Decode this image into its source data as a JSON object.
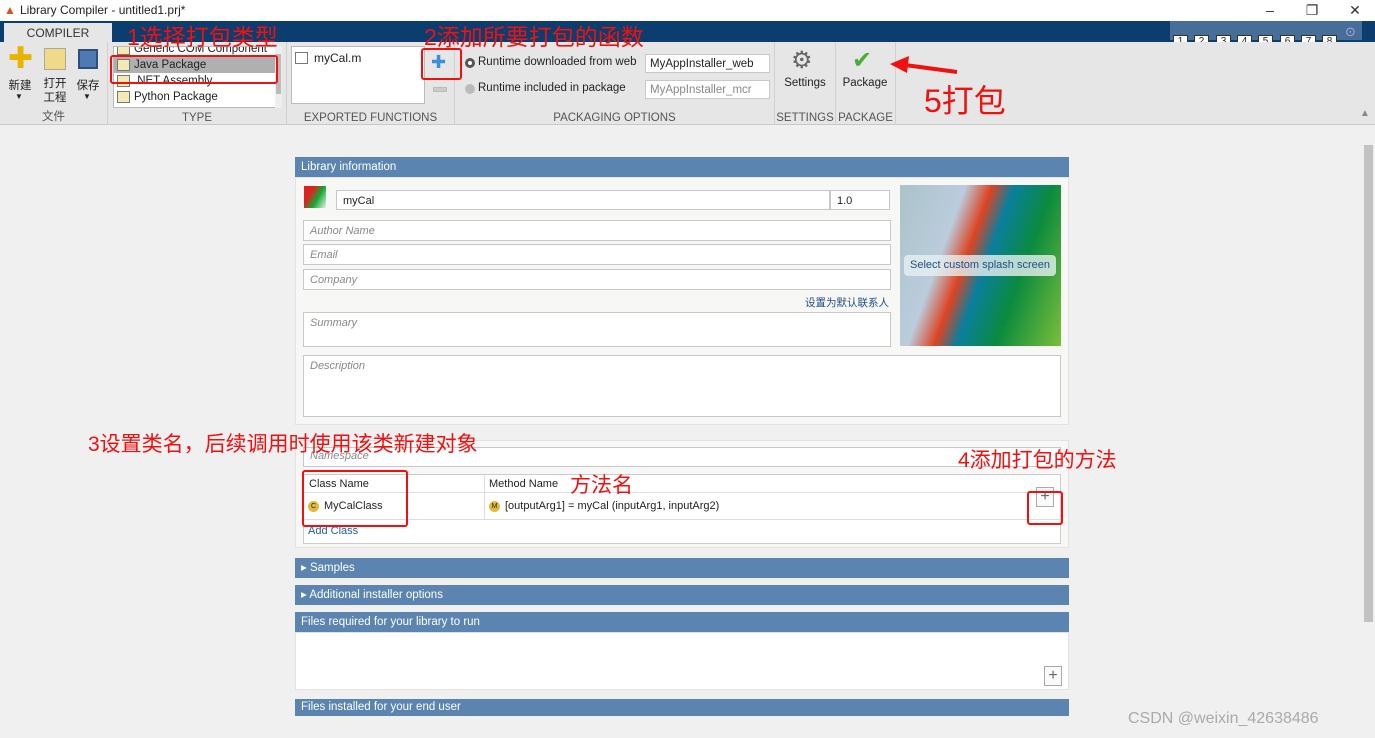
{
  "window": {
    "title": "Library Compiler - untitled1.prj*",
    "controls": [
      "minimize",
      "restore",
      "close"
    ]
  },
  "toolstrip": {
    "tab": "COMPILER",
    "quick_access": [
      "1",
      "2",
      "3",
      "4",
      "5",
      "6",
      "7",
      "8"
    ]
  },
  "file_section": {
    "label": "文件",
    "new": "新建",
    "open_line1": "打开",
    "open_line2": "工程",
    "save": "保存"
  },
  "type_section": {
    "label": "TYPE",
    "items": [
      "Generic COM Component",
      "Java Package",
      ".NET Assembly",
      "Python Package"
    ],
    "selected": "Java Package"
  },
  "exported_section": {
    "label": "EXPORTED FUNCTIONS",
    "files": [
      "myCal.m"
    ]
  },
  "packaging_section": {
    "label": "PACKAGING OPTIONS",
    "opt_web": "Runtime downloaded from web",
    "web_value": "MyAppInstaller_web",
    "opt_included": "Runtime included in package",
    "included_value": "MyAppInstaller_mcr",
    "selected": "web"
  },
  "settings_section": {
    "label": "SETTINGS",
    "button": "Settings"
  },
  "package_section": {
    "label": "PACKAGE",
    "button": "Package"
  },
  "library_info": {
    "header": "Library information",
    "name": "myCal",
    "version": "1.0",
    "author_placeholder": "Author Name",
    "email_placeholder": "Email",
    "company_placeholder": "Company",
    "default_contact": "设置为默认联系人",
    "summary_placeholder": "Summary",
    "description_placeholder": "Description",
    "splash": "Select custom splash screen"
  },
  "class_map": {
    "namespace_placeholder": "Namespace",
    "col_class": "Class Name",
    "col_method": "Method Name",
    "class_name": "MyCalClass",
    "method": "[outputArg1] = myCal (inputArg1, inputArg2)",
    "add_class": "Add Class"
  },
  "sections": {
    "samples": "Samples",
    "installer": "Additional installer options",
    "files_required": "Files required for your library to run",
    "files_installed": "Files installed for your end user"
  },
  "annotations": {
    "a1": "1选择打包类型",
    "a2": "2添加所要打包的函数",
    "a3": "3设置类名，后续调用时使用该类新建对象",
    "a4": "4添加打包的方法",
    "a5": "5打包",
    "method_label": "方法名"
  },
  "watermark": "CSDN @weixin_42638486",
  "colors": {
    "toolstrip": "#0b3d6e",
    "section_header": "#5b84b1",
    "annotation": "#f01010"
  }
}
